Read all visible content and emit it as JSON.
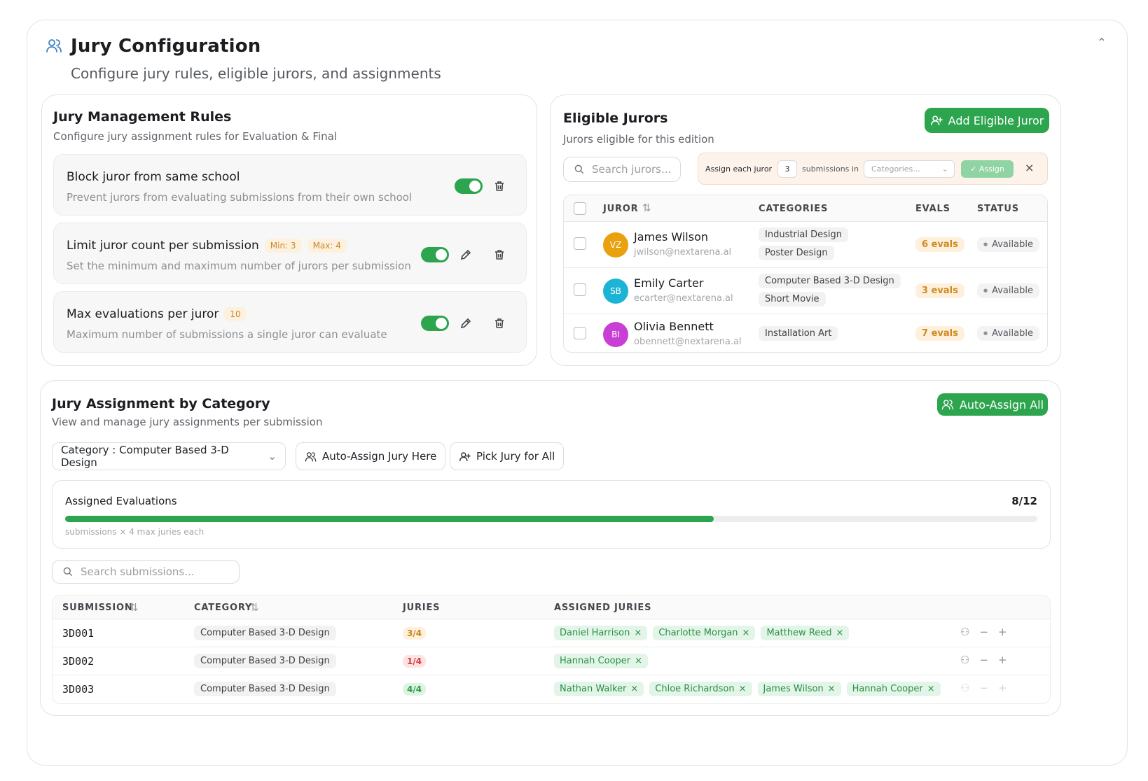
{
  "header": {
    "title": "Jury Configuration",
    "subtitle": "Configure jury rules, eligible jurors, and assignments",
    "icons": {
      "title": "users-icon",
      "collapse": "chevron-up-icon"
    }
  },
  "rules": {
    "title": "Jury Management Rules",
    "subtitle": "Configure jury assignment rules for Evaluation & Final",
    "items": [
      {
        "title": "Block juror from same school",
        "description": "Prevent jurors from evaluating submissions from their own school",
        "badges": [],
        "enabled": true,
        "editable": false
      },
      {
        "title": "Limit juror count per submission",
        "description": "Set the minimum and maximum number of jurors per submission",
        "badges": [
          "Min: 3",
          "Max: 4"
        ],
        "enabled": true,
        "editable": true
      },
      {
        "title": "Max evaluations per juror",
        "description": "Maximum number of submissions a single juror can evaluate",
        "badges": [
          "10"
        ],
        "enabled": true,
        "editable": true
      }
    ]
  },
  "jurors": {
    "title": "Eligible Jurors",
    "subtitle": "Jurors eligible for this edition",
    "add_button": "Add Eligible Juror",
    "search_placeholder": "Search jurors...",
    "assign_bar": {
      "prefix": "Assign each juror",
      "count": "3",
      "middle": "submissions in",
      "select_placeholder": "Categories...",
      "button": "Assign",
      "close": "×"
    },
    "columns": {
      "juror": "JUROR",
      "categories": "CATEGORIES",
      "evals": "EVALS",
      "status": "STATUS"
    },
    "rows": [
      {
        "initials": "VZ",
        "color": "#e9a10f",
        "name": "James Wilson",
        "email": "jwilson@nextarena.al",
        "categories": [
          "Industrial Design",
          "Poster Design"
        ],
        "evals": "6 evals",
        "status": "Available"
      },
      {
        "initials": "SB",
        "color": "#1cb4d4",
        "name": "Emily Carter",
        "email": "ecarter@nextarena.al",
        "categories": [
          "Computer Based 3-D Design",
          "Short Movie"
        ],
        "evals": "3 evals",
        "status": "Available"
      },
      {
        "initials": "BI",
        "color": "#c93fd6",
        "name": "Olivia Bennett",
        "email": "obennett@nextarena.al",
        "categories": [
          "Installation Art"
        ],
        "evals": "7 evals",
        "status": "Available"
      }
    ]
  },
  "assignment": {
    "title": "Jury Assignment by Category",
    "subtitle": "View and manage jury assignments per submission",
    "auto_assign_all": "Auto-Assign All",
    "category_filter": "Category : Computer Based 3-D Design",
    "auto_assign_here": "Auto-Assign Jury Here",
    "pick_jury_all": "Pick Jury for All",
    "progress": {
      "label": "Assigned Evaluations",
      "count": "8/12",
      "fraction": 0.667,
      "note": "submissions × 4 max juries each"
    },
    "search_placeholder": "Search submissions...",
    "columns": {
      "submission": "SUBMISSION",
      "category": "CATEGORY",
      "juries": "JURIES",
      "assigned": "ASSIGNED JURIES"
    },
    "rows": [
      {
        "id": "3D001",
        "category": "Computer Based 3-D Design",
        "juries": "3/4",
        "juries_state": "partial",
        "assigned": [
          "Daniel Harrison",
          "Charlotte Morgan",
          "Matthew Reed"
        ]
      },
      {
        "id": "3D002",
        "category": "Computer Based 3-D Design",
        "juries": "1/4",
        "juries_state": "low",
        "assigned": [
          "Hannah Cooper"
        ]
      },
      {
        "id": "3D003",
        "category": "Computer Based 3-D Design",
        "juries": "4/4",
        "juries_state": "full",
        "assigned": [
          "Nathan Walker",
          "Chloe Richardson",
          "James Wilson",
          "Hannah Cooper"
        ]
      }
    ]
  }
}
